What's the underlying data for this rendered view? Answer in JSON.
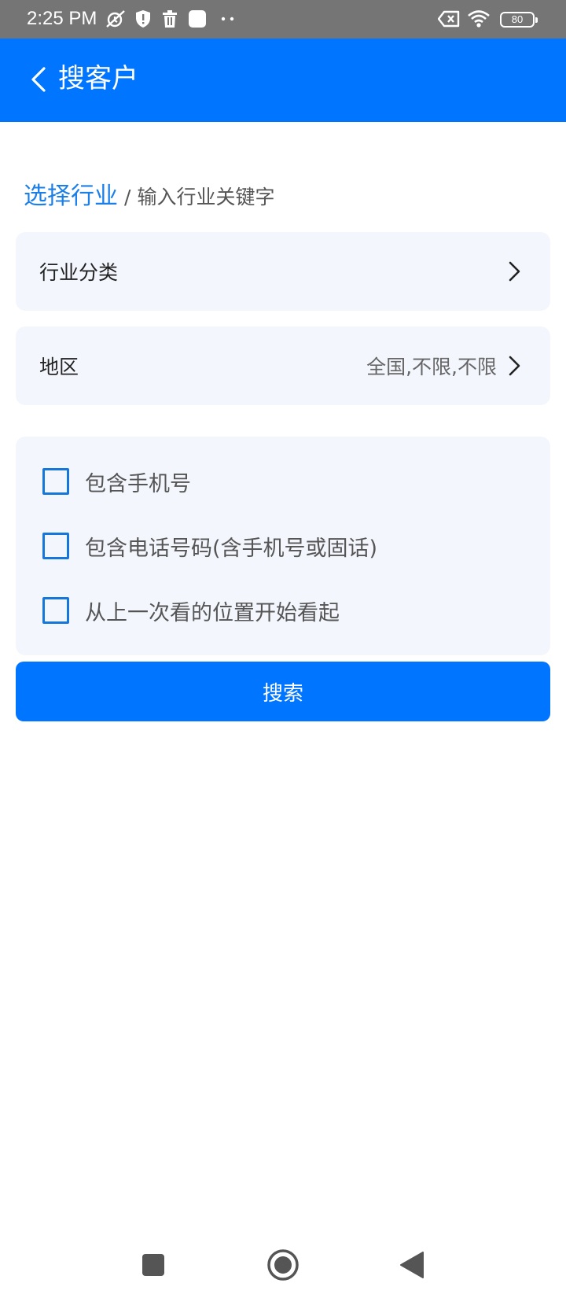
{
  "status_bar": {
    "time": "2:25 PM",
    "battery": "80",
    "icons": [
      "alarm-off-icon",
      "shield-icon",
      "trash-icon",
      "square-app-icon",
      "more-dots-icon",
      "sim-x-icon",
      "wifi-icon",
      "battery-icon"
    ]
  },
  "app_bar": {
    "title": "搜客户",
    "back_icon": "chevron-left-icon"
  },
  "breadcrumb": {
    "active": "选择行业",
    "separator": "/",
    "other": "输入行业关键字"
  },
  "filters": {
    "industry": {
      "label": "行业分类",
      "value": ""
    },
    "region": {
      "label": "地区",
      "value": "全国,不限,不限"
    }
  },
  "options": [
    {
      "label": "包含手机号",
      "checked": false
    },
    {
      "label": "包含电话号码(含手机号或固话)",
      "checked": false
    },
    {
      "label": "从上一次看的位置开始看起",
      "checked": false
    }
  ],
  "search_button": "搜索",
  "colors": {
    "primary": "#0075FF",
    "link": "#1A7FE8",
    "card_bg": "#F3F7FD",
    "status_bar": "#757575"
  }
}
